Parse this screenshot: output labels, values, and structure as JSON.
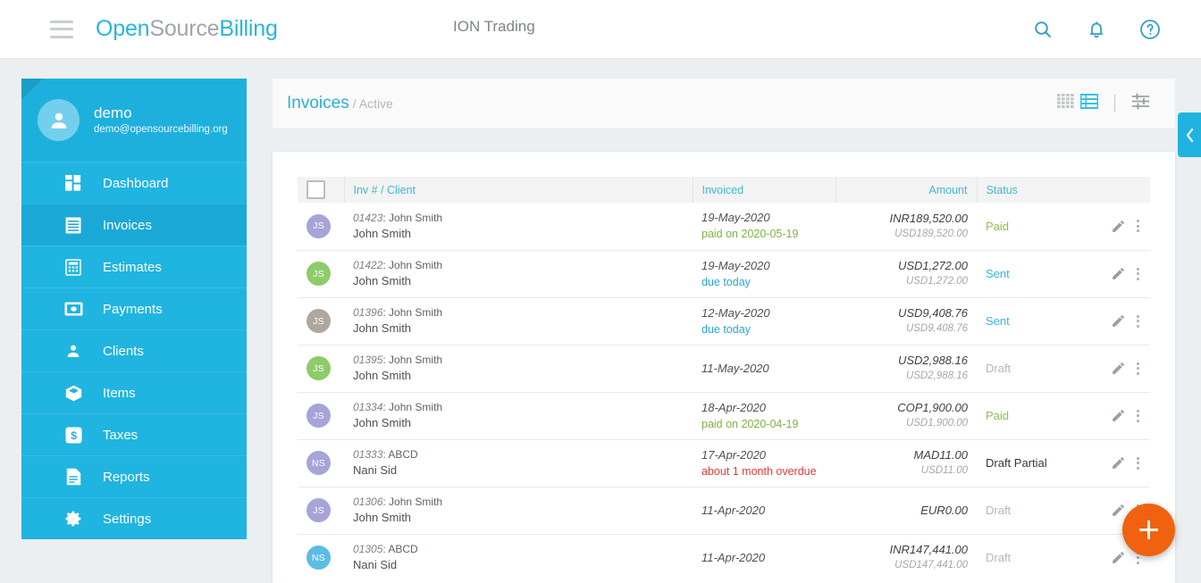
{
  "topbar": {
    "menu_icon": "hamburger-icon",
    "brand": {
      "part1": "Open",
      "part2": "Source",
      "part3": "Billing"
    },
    "company": "ION Trading",
    "icons": [
      {
        "name": "search-icon",
        "label": "Search"
      },
      {
        "name": "bell-icon",
        "label": "Notifications"
      },
      {
        "name": "help-icon",
        "label": "Help"
      }
    ]
  },
  "sidebar": {
    "user": {
      "name": "demo",
      "email": "demo@opensourcebilling.org",
      "avatar_icon": "user-avatar-icon"
    },
    "items": [
      {
        "label": "Dashboard",
        "icon": "dashboard-icon",
        "active": false
      },
      {
        "label": "Invoices",
        "icon": "invoice-icon",
        "active": true
      },
      {
        "label": "Estimates",
        "icon": "calculator-icon",
        "active": false
      },
      {
        "label": "Payments",
        "icon": "payment-icon",
        "active": false
      },
      {
        "label": "Clients",
        "icon": "person-icon",
        "active": false
      },
      {
        "label": "Items",
        "icon": "box-icon",
        "active": false
      },
      {
        "label": "Taxes",
        "icon": "dollar-icon",
        "active": false
      },
      {
        "label": "Reports",
        "icon": "document-icon",
        "active": false
      },
      {
        "label": "Settings",
        "icon": "gear-icon",
        "active": false
      }
    ]
  },
  "content_header": {
    "title": "Invoices",
    "breadcrumb_sep": "/ Active",
    "tools": [
      {
        "name": "grid-view-icon",
        "active": false
      },
      {
        "name": "list-view-icon",
        "active": true
      },
      {
        "name": "filter-settings-icon",
        "active": false
      }
    ]
  },
  "table": {
    "select_all_checkbox": "unchecked",
    "columns": [
      "Inv # / Client",
      "Invoiced",
      "Amount",
      "Status"
    ],
    "rows": [
      {
        "initials": "JS",
        "avatar_color": "#a6a4d8",
        "invoice_no": "01423",
        "invoice_client": "John Smith",
        "client": "John Smith",
        "date": "19-May-2020",
        "date_note": "paid on 2020-05-19",
        "date_note_type": "paid",
        "amount": "INR189,520.00",
        "amount_usd": "USD189,520.00",
        "status": "Paid",
        "status_type": "paid"
      },
      {
        "initials": "JS",
        "avatar_color": "#8ecb6b",
        "invoice_no": "01422",
        "invoice_client": "John Smith",
        "client": "John Smith",
        "date": "19-May-2020",
        "date_note": "due today",
        "date_note_type": "due",
        "amount": "USD1,272.00",
        "amount_usd": "USD1,272.00",
        "status": "Sent",
        "status_type": "sent"
      },
      {
        "initials": "JS",
        "avatar_color": "#aea79d",
        "invoice_no": "01396",
        "invoice_client": "John Smith",
        "client": "John Smith",
        "date": "12-May-2020",
        "date_note": "due today",
        "date_note_type": "due",
        "amount": "USD9,408.76",
        "amount_usd": "USD9,408.76",
        "status": "Sent",
        "status_type": "sent"
      },
      {
        "initials": "JS",
        "avatar_color": "#8ecb6b",
        "invoice_no": "01395",
        "invoice_client": "John Smith",
        "client": "John Smith",
        "date": "11-May-2020",
        "date_note": "",
        "date_note_type": "",
        "amount": "USD2,988.16",
        "amount_usd": "USD2,988.16",
        "status": "Draft",
        "status_type": "draft"
      },
      {
        "initials": "JS",
        "avatar_color": "#a6a4d8",
        "invoice_no": "01334",
        "invoice_client": "John Smith",
        "client": "John Smith",
        "date": "18-Apr-2020",
        "date_note": "paid on 2020-04-19",
        "date_note_type": "paid",
        "amount": "COP1,900.00",
        "amount_usd": "USD1,900.00",
        "status": "Paid",
        "status_type": "paid"
      },
      {
        "initials": "NS",
        "avatar_color": "#a6a4d8",
        "invoice_no": "01333",
        "invoice_client": "ABCD",
        "client": "Nani Sid",
        "date": "17-Apr-2020",
        "date_note": "about 1 month overdue",
        "date_note_type": "over",
        "amount": "MAD11.00",
        "amount_usd": "USD11.00",
        "status": "Draft Partial",
        "status_type": "partial"
      },
      {
        "initials": "JS",
        "avatar_color": "#a6a4d8",
        "invoice_no": "01306",
        "invoice_client": "John Smith",
        "client": "John Smith",
        "date": "11-Apr-2020",
        "date_note": "",
        "date_note_type": "",
        "amount": "EUR0.00",
        "amount_usd": "",
        "status": "Draft",
        "status_type": "draft"
      },
      {
        "initials": "NS",
        "avatar_color": "#5bbce4",
        "invoice_no": "01305",
        "invoice_client": "ABCD",
        "client": "Nani Sid",
        "date": "11-Apr-2020",
        "date_note": "",
        "date_note_type": "",
        "amount": "INR147,441.00",
        "amount_usd": "USD147,441.00",
        "status": "Draft",
        "status_type": "draft"
      }
    ],
    "row_actions": {
      "edit_icon": "pencil-icon",
      "more_icon": "more-vertical-icon"
    }
  },
  "fab": {
    "icon": "plus-icon",
    "label": "+"
  },
  "right_tab": {
    "icon": "chevron-left-icon"
  },
  "colors": {
    "brand_cyan": "#29b6d8",
    "sidebar_blue": "#20b4e0",
    "fab_orange": "#f0620f",
    "status_paid": "#8bc34a",
    "status_sent": "#37b4dc",
    "status_draft": "#b2b8bb",
    "overdue_red": "#e53935",
    "page_bg": "#eceff1"
  }
}
